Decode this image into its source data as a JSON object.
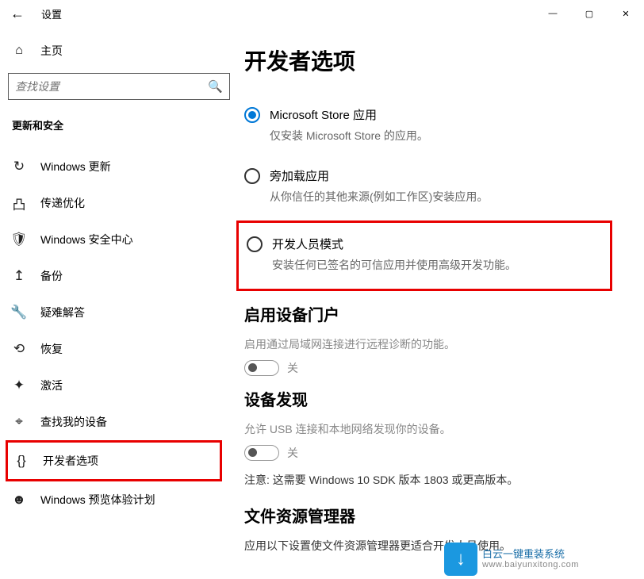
{
  "window": {
    "title": "设置",
    "home": "主页",
    "search_placeholder": "查找设置",
    "min": "—",
    "max": "▢",
    "close": "✕"
  },
  "sidebar": {
    "section": "更新和安全",
    "items": [
      {
        "icon": "↻",
        "label": "Windows 更新"
      },
      {
        "icon": "凸",
        "label": "传递优化"
      },
      {
        "icon": "🛡",
        "label": "Windows 安全中心"
      },
      {
        "icon": "↥",
        "label": "备份"
      },
      {
        "icon": "🔧",
        "label": "疑难解答"
      },
      {
        "icon": "⟲",
        "label": "恢复"
      },
      {
        "icon": "✦",
        "label": "激活"
      },
      {
        "icon": "⌖",
        "label": "查找我的设备"
      },
      {
        "icon": "{}",
        "label": "开发者选项"
      },
      {
        "icon": "☻",
        "label": "Windows 预览体验计划"
      }
    ]
  },
  "main": {
    "title": "开发者选项",
    "radio": [
      {
        "label": "Microsoft Store 应用",
        "desc": "仅安装 Microsoft Store 的应用。",
        "selected": true
      },
      {
        "label": "旁加载应用",
        "desc": "从你信任的其他来源(例如工作区)安装应用。",
        "selected": false
      },
      {
        "label": "开发人员模式",
        "desc": "安装任何已签名的可信应用并使用高级开发功能。",
        "selected": false
      }
    ],
    "portal": {
      "heading": "启用设备门户",
      "desc": "启用通过局域网连接进行远程诊断的功能。",
      "state": "关"
    },
    "discovery": {
      "heading": "设备发现",
      "desc": "允许 USB 连接和本地网络发现你的设备。",
      "state": "关",
      "note": "注意: 这需要 Windows 10 SDK 版本 1803 或更高版本。"
    },
    "explorer": {
      "heading": "文件资源管理器",
      "desc": "应用以下设置使文件资源管理器更适合开发人员使用。"
    }
  },
  "watermark": {
    "text": "白云一键重装系统",
    "url": "www.baiyunxitong.com"
  }
}
